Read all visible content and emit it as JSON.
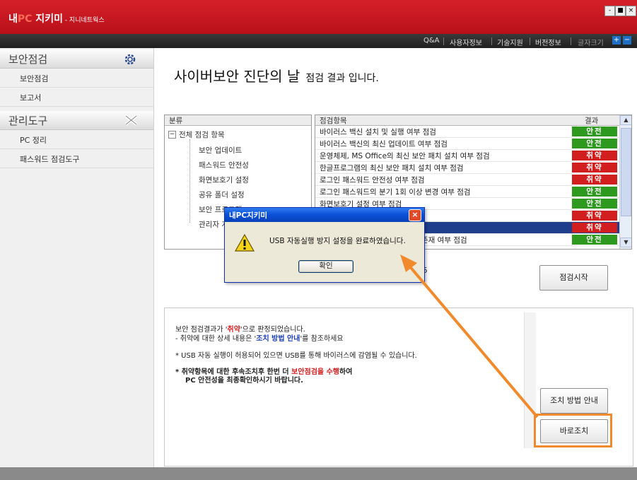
{
  "app": {
    "title_prefix": "내",
    "title_pc": "PC",
    "title_suffix": " 지키미",
    "subtitle": " - 지니네트웍스",
    "win_min": "-",
    "win_max": "■",
    "win_close": "×"
  },
  "topmenu": {
    "items": [
      "Q&A",
      "사용자정보",
      "기술지원",
      "버전정보",
      "글자크기"
    ],
    "font_plus": "+",
    "font_minus": "−"
  },
  "sidebar": {
    "sections": [
      {
        "label": "보안점검",
        "icon": "gear-icon",
        "items": [
          "보안점검",
          "보고서"
        ]
      },
      {
        "label": "관리도구",
        "icon": "tools-icon",
        "items": [
          "PC 정리",
          "패스워드 점검도구"
        ]
      }
    ]
  },
  "main": {
    "heading_big": "사이버보안 진단의 날",
    "heading_small": "점검 결과 입니다."
  },
  "tree": {
    "header": "분류",
    "root_toggle": "−",
    "root": "전체 점검 항목",
    "children": [
      "보안 업데이트",
      "패스워드 안전성",
      "화면보호기 설정",
      "공유 폴더 설정",
      "보안 프로그램",
      "관리자 계정"
    ]
  },
  "results": {
    "col_item": "점검항목",
    "col_result": "결과",
    "scroll_up": "▲",
    "scroll_down": "▼",
    "rows": [
      {
        "item": "바이러스 백신 설치 및 실행 여부 점검",
        "result": "안전",
        "status": "safe"
      },
      {
        "item": "바이러스 백신의 최신 업데이트 여부 점검",
        "result": "안전",
        "status": "safe"
      },
      {
        "item": "운영체제, MS Office의 최신 보안 패치 설치 여부 점검",
        "result": "취약",
        "status": "weak"
      },
      {
        "item": "한글프로그램의 최신 보안 패치 설치 여부 점검",
        "result": "취약",
        "status": "weak"
      },
      {
        "item": "로그인 패스워드 안전성 여부 점검",
        "result": "취약",
        "status": "weak"
      },
      {
        "item": "로그인 패스워드의 분기 1회 이상 변경 여부 점검",
        "result": "안전",
        "status": "safe"
      },
      {
        "item": "화면보호기 설정 여부 점검",
        "result": "안전",
        "status": "safe"
      },
      {
        "item": "",
        "result": "취약",
        "status": "weak"
      },
      {
        "item": "",
        "result": "취약",
        "status": "weak",
        "selected": true
      },
      {
        "item": "존재 여부 점검",
        "result": "안전",
        "status": "safe"
      }
    ]
  },
  "score_fragment": "5",
  "start_button": "점검시작",
  "info": {
    "line1_pre": "보안 점검결과가 '",
    "line1_red": "취약",
    "line1_post": "'으로 판정되었습니다.",
    "line2_pre": "- 취약에 대한 상세 내용은 '",
    "line2_blue": "조치 방법 안내",
    "line2_post": "'를 참조하세요",
    "line3": "* USB 자동 실행이 허용되어 있으면 USB를 통해 바이러스에 감염될 수 있습니다.",
    "line4_pre": "* 취약항목에 대한 후속조치후 한번 더 ",
    "line4_red": "보안점검을 수행",
    "line4_post": "하여",
    "line5": "PC 안전성을 최종확인하시기 바랍니다.",
    "guide_button": "조치 방법 안내",
    "fix_button": "바로조치"
  },
  "dialog": {
    "title": "내PC지키미",
    "message": "USB 자동실행 방지 설정을 완료하였습니다.",
    "ok": "확인",
    "close": "×"
  },
  "colors": {
    "brand_red": "#c8141b",
    "safe": "#2d9a1f",
    "weak": "#d11f1f",
    "highlight_orange": "#f08a2c"
  }
}
